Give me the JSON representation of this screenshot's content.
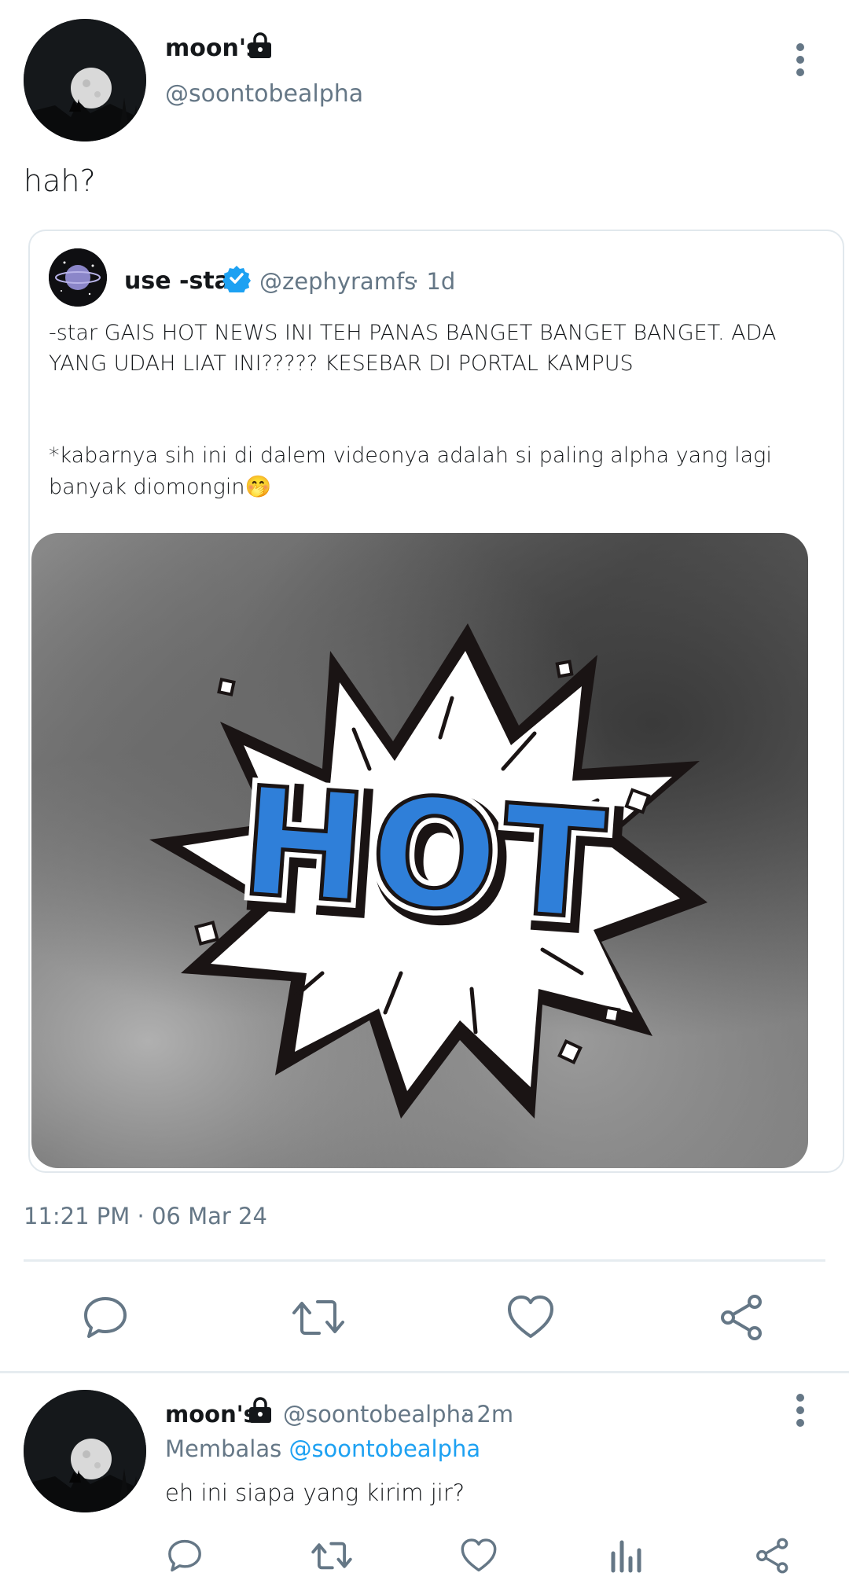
{
  "main_tweet": {
    "display_name": "moon's",
    "handle": "@soontobealpha",
    "text": "hah?",
    "timestamp": "11:21 PM · 06 Mar 24",
    "lock_icon": "lock-icon",
    "more_icon": "more-vertical-icon"
  },
  "quoted_tweet": {
    "display_name": "use -star",
    "handle": "@zephyramfs",
    "time_ago": "· 1d",
    "verified_icon": "verified-badge-icon",
    "text_line1": "-star GAIS HOT NEWS INI TEH PANAS BANGET BANGET BANGET. ADA",
    "text_line2": "YANG UDAH LIAT INI????? KESEBAR DI PORTAL KAMPUS",
    "text_line3": "*kabarnya sih ini di dalem videonya adalah si paling alpha yang lagi",
    "text_line4": "banyak diomongin🤭",
    "media_text": "HOT"
  },
  "actions": {
    "reply_icon": "reply-icon",
    "retweet_icon": "retweet-icon",
    "like_icon": "heart-icon",
    "share_icon": "share-icon",
    "stats_icon": "stats-icon"
  },
  "reply_tweet": {
    "display_name": "moon's",
    "handle": "@soontobealpha",
    "time_ago": "· 2m",
    "replying_label": "Membalas",
    "replying_to": "@soontobealpha",
    "text": "eh ini siapa yang kirim jir?"
  },
  "colors": {
    "accent": "#1da1f2",
    "muted": "#657786",
    "hot_blue": "#2f7fd9",
    "divider": "#e6ecf0"
  }
}
